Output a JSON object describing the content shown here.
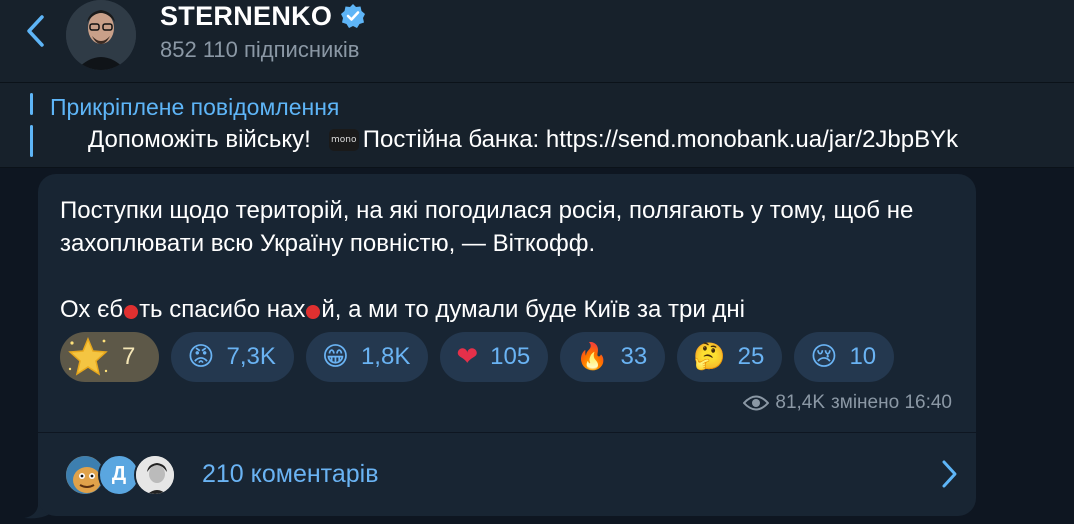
{
  "header": {
    "channel_name": "STERNENKO",
    "subscribers": "852 110 підписників",
    "icons": [
      "back-chevron-icon",
      "verified-badge-icon"
    ]
  },
  "pinned": {
    "title": "Прикріплене повідомлення",
    "text_prefix": "Допоможіть війську!",
    "icon_label": "mono",
    "text_suffix": "Постійна банка: https://send.monobank.ua/jar/2JbpBYk"
  },
  "message": {
    "paragraph1": "Поступки щодо територій, на які погодилася росія, полягають у тому, щоб не захоплювати всю Україну повністю, — Віткофф.",
    "p2_part1": "Ох єб",
    "p2_part2": "ть спасибо нах",
    "p2_part3": "й, а ми то думали буде Київ за три дні",
    "reactions": [
      {
        "emoji": "⭐",
        "icon": "star-icon",
        "count": "7",
        "selected": true
      },
      {
        "emoji": "😡",
        "icon": "angry-face-icon",
        "count": "7,3K"
      },
      {
        "emoji": "😁",
        "icon": "grin-face-icon",
        "count": "1,8K"
      },
      {
        "emoji": "❤",
        "icon": "heart-icon",
        "count": "105"
      },
      {
        "emoji": "🔥",
        "icon": "fire-icon",
        "count": "33"
      },
      {
        "emoji": "🤔",
        "icon": "thinking-face-icon",
        "count": "25"
      },
      {
        "emoji": "😢",
        "icon": "crying-face-icon",
        "count": "10"
      }
    ],
    "views": "81,4K",
    "edited_time": "змінено 16:40",
    "comments": {
      "avatar_letter": "Д",
      "label": "210 коментарів"
    }
  },
  "colors": {
    "background": "#0e1621",
    "panel": "#17212b",
    "bubble": "#182533",
    "accent": "#5eb5f7",
    "muted": "#8b98a5"
  }
}
